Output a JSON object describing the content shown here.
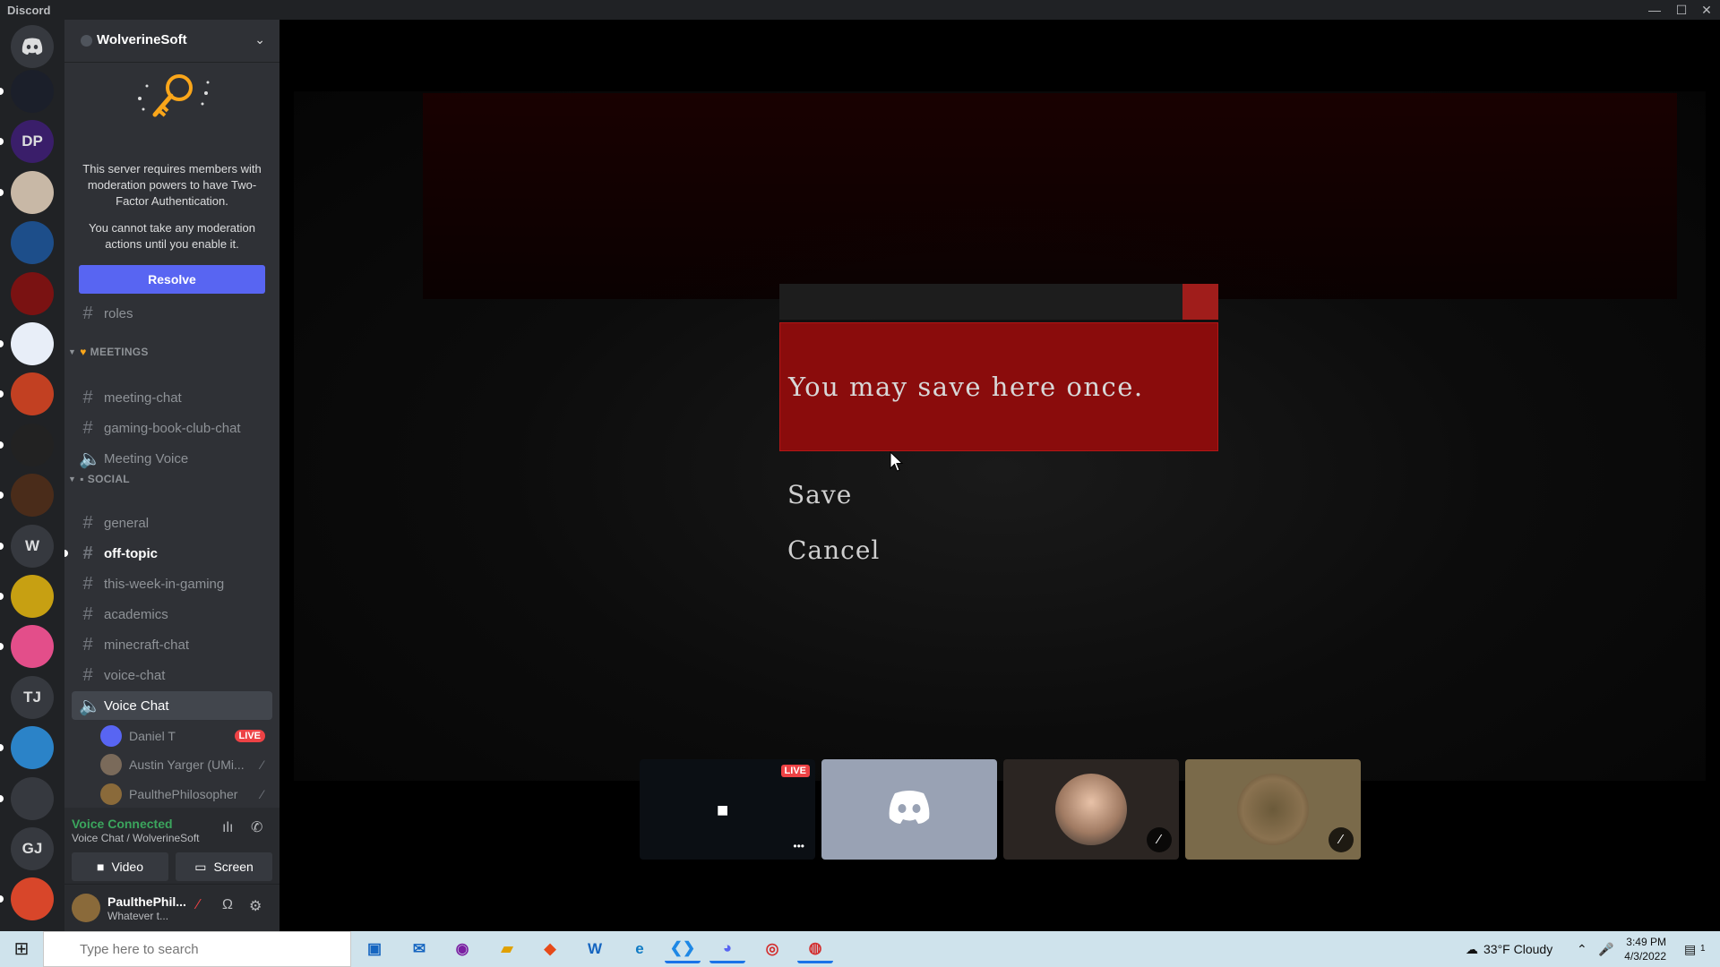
{
  "window": {
    "title": "Discord",
    "minimize": "—",
    "maximize": "☐",
    "close": "✕"
  },
  "rail": {
    "servers": [
      {
        "name": "home-icon",
        "initials": "",
        "color": "#36393f",
        "pill": false
      },
      {
        "name": "server-1",
        "initials": "",
        "color": "#1b1f2a",
        "pill": true
      },
      {
        "name": "server-dp",
        "initials": "DP",
        "color": "#3a1e6a",
        "pill": true
      },
      {
        "name": "server-3",
        "initials": "",
        "color": "#c8b8a6",
        "pill": true
      },
      {
        "name": "server-4",
        "initials": "",
        "color": "#1d4e8a",
        "pill": false
      },
      {
        "name": "server-5",
        "initials": "",
        "color": "#7a1212",
        "pill": false
      },
      {
        "name": "server-6",
        "initials": "",
        "color": "#e8eef8",
        "pill": true
      },
      {
        "name": "server-7",
        "initials": "",
        "color": "#c24022",
        "pill": true
      },
      {
        "name": "server-8",
        "initials": "",
        "color": "#222222",
        "pill": true
      },
      {
        "name": "server-9",
        "initials": "",
        "color": "#4a2c1a",
        "pill": true
      },
      {
        "name": "server-w",
        "initials": "W",
        "color": "#36393f",
        "pill": true
      },
      {
        "name": "server-11",
        "initials": "",
        "color": "#c7a012",
        "pill": true
      },
      {
        "name": "server-12",
        "initials": "",
        "color": "#e34e8a",
        "pill": true
      },
      {
        "name": "server-tj",
        "initials": "TJ",
        "color": "#36393f",
        "pill": false
      },
      {
        "name": "server-14",
        "initials": "",
        "color": "#2b83c8",
        "pill": true
      },
      {
        "name": "server-15",
        "initials": "",
        "color": "#36393f",
        "pill": true
      },
      {
        "name": "server-gj",
        "initials": "GJ",
        "color": "#36393f",
        "pill": false
      },
      {
        "name": "server-17",
        "initials": "",
        "color": "#d8462a",
        "pill": true
      }
    ]
  },
  "server": {
    "name": "WolverineSoft",
    "notice_p1": "This server requires members with moderation powers to have Two-Factor Authentication.",
    "notice_p2": "You cannot take any moderation actions until you enable it.",
    "resolve_label": "Resolve"
  },
  "channels": {
    "roles": "roles",
    "cat_meetings": "MEETINGS",
    "meeting_chat": "meeting-chat",
    "gaming_book": "gaming-book-club-chat",
    "meeting_voice": "Meeting Voice",
    "cat_social": "SOCIAL",
    "general": "general",
    "off_topic": "off-topic",
    "this_week": "this-week-in-gaming",
    "academics": "academics",
    "minecraft": "minecraft-chat",
    "voice_chat_text": "voice-chat",
    "voice_chat": "Voice Chat",
    "users": [
      {
        "name": "Daniel T",
        "live": "LIVE",
        "avatar_color": "#5865f2"
      },
      {
        "name": "Austin Yarger (UMi...",
        "avatar_color": "#7a6a5a"
      },
      {
        "name": "PaulthePhilosopher",
        "avatar_color": "#8a6a3a"
      }
    ]
  },
  "voice": {
    "status": "Voice Connected",
    "location": "Voice Chat / WolverineSoft",
    "video_label": "Video",
    "screen_label": "Screen"
  },
  "user": {
    "name": "PaulthePhil...",
    "status": "Whatever t..."
  },
  "game": {
    "message": "You may save here once.",
    "option_save": "Save",
    "option_cancel": "Cancel"
  },
  "tiles": {
    "live_label": "LIVE",
    "more": "•••"
  },
  "taskbar": {
    "search_placeholder": "Type here to search",
    "weather": "33°F  Cloudy",
    "time": "3:49 PM",
    "date": "4/3/2022",
    "notifications": "1"
  }
}
